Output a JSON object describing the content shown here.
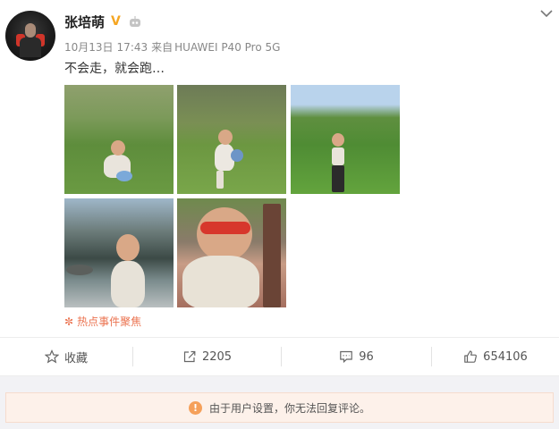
{
  "post": {
    "username": "张培萌",
    "verified_badge": "V",
    "date": "10月13日",
    "time": "17:43",
    "source_prefix": "来自",
    "source_device": "HUAWEI P40 Pro 5G",
    "text": "不会走，就会跑…",
    "photos": [
      {
        "icon": "photo-kid-grass-sitting"
      },
      {
        "icon": "photo-kid-grass-ball"
      },
      {
        "icon": "photo-kid-field-trees"
      },
      {
        "icon": "photo-kid-canal"
      },
      {
        "icon": "photo-kid-sunglasses"
      }
    ],
    "hot_event_label": "热点事件聚焦"
  },
  "actions": {
    "favorite_label": "收藏",
    "repost_count": "2205",
    "comment_count": "96",
    "like_count": "654106"
  },
  "notice": {
    "icon": "!",
    "text": "由于用户设置，你无法回复评论。"
  },
  "colors": {
    "accent_orange": "#eb7350",
    "verified_gold": "#f5a623",
    "notice_bg": "#fdf1ea"
  }
}
